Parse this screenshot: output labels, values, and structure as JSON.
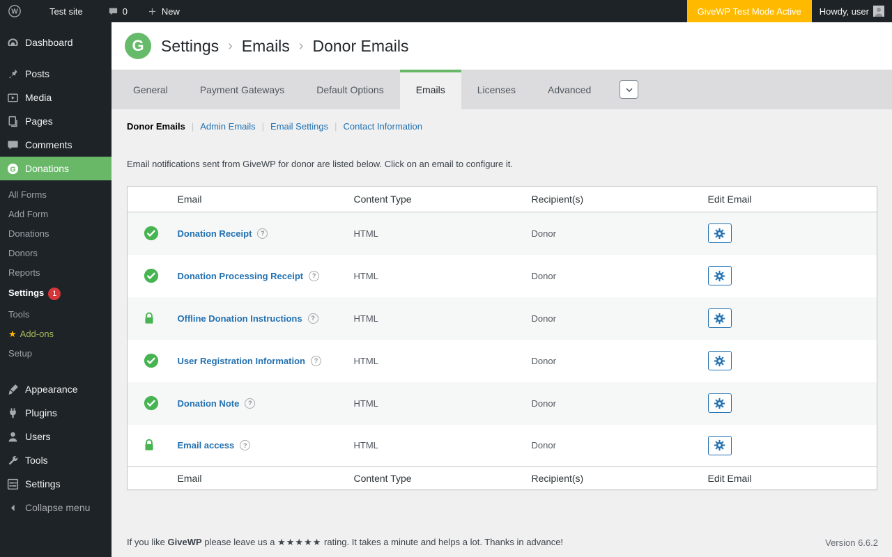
{
  "admin_bar": {
    "site_name": "Test site",
    "comments_count": "0",
    "new_label": "New",
    "test_mode_label": "GiveWP Test Mode Active",
    "greeting": "Howdy, user"
  },
  "sidebar": {
    "items": [
      {
        "label": "Dashboard"
      },
      {
        "label": "Posts"
      },
      {
        "label": "Media"
      },
      {
        "label": "Pages"
      },
      {
        "label": "Comments"
      },
      {
        "label": "Donations",
        "active": true
      }
    ],
    "submenu": [
      {
        "label": "All Forms"
      },
      {
        "label": "Add Form"
      },
      {
        "label": "Donations"
      },
      {
        "label": "Donors"
      },
      {
        "label": "Reports"
      },
      {
        "label": "Settings",
        "badge": "1",
        "current": true
      },
      {
        "label": "Tools"
      },
      {
        "label": "Add-ons",
        "star": "★"
      },
      {
        "label": "Setup"
      }
    ],
    "lower_items": [
      {
        "label": "Appearance"
      },
      {
        "label": "Plugins"
      },
      {
        "label": "Users"
      },
      {
        "label": "Tools"
      },
      {
        "label": "Settings"
      }
    ],
    "collapse_label": "Collapse menu"
  },
  "header": {
    "breadcrumb": [
      "Settings",
      "Emails",
      "Donor Emails"
    ],
    "separator": "›"
  },
  "tabs": {
    "items": [
      {
        "label": "General"
      },
      {
        "label": "Payment Gateways"
      },
      {
        "label": "Default Options"
      },
      {
        "label": "Emails",
        "active": true
      },
      {
        "label": "Licenses"
      },
      {
        "label": "Advanced"
      }
    ]
  },
  "subnav": {
    "separator": "|",
    "items": [
      {
        "label": "Donor Emails",
        "active": true
      },
      {
        "label": "Admin Emails"
      },
      {
        "label": "Email Settings"
      },
      {
        "label": "Contact Information"
      }
    ]
  },
  "description": "Email notifications sent from GiveWP for donor are listed below. Click on an email to configure it.",
  "table": {
    "columns": {
      "email": "Email",
      "content_type": "Content Type",
      "recipients": "Recipient(s)",
      "edit": "Edit Email"
    },
    "rows": [
      {
        "status": "enabled",
        "name": "Donation Receipt",
        "content_type": "HTML",
        "recipients": "Donor"
      },
      {
        "status": "enabled",
        "name": "Donation Processing Receipt",
        "content_type": "HTML",
        "recipients": "Donor"
      },
      {
        "status": "locked",
        "name": "Offline Donation Instructions",
        "content_type": "HTML",
        "recipients": "Donor"
      },
      {
        "status": "enabled",
        "name": "User Registration Information",
        "content_type": "HTML",
        "recipients": "Donor"
      },
      {
        "status": "enabled",
        "name": "Donation Note",
        "content_type": "HTML",
        "recipients": "Donor"
      },
      {
        "status": "locked",
        "name": "Email access",
        "content_type": "HTML",
        "recipients": "Donor"
      }
    ]
  },
  "footer": {
    "like_prefix": "If you like",
    "brand": "GiveWP",
    "like_middle": "please leave us a",
    "stars": "★★★★★",
    "like_suffix": "rating. It takes a minute and helps a lot. Thanks in advance!",
    "version": "Version 6.6.2"
  },
  "colors": {
    "brand_green": "#69b868",
    "status_green": "#46b450",
    "link_blue": "#2271b1",
    "test_mode_orange": "#ffba00",
    "badge_red": "#d63638",
    "admin_dark": "#1d2327"
  },
  "icons": {
    "status_enabled": "check-circle",
    "status_locked": "padlock",
    "edit_email": "gear",
    "help": "question-circle",
    "tabs_overflow": "chevron-down"
  }
}
